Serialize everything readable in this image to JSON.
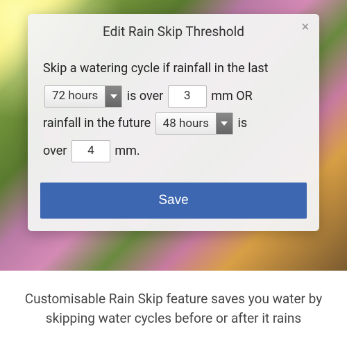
{
  "dialog": {
    "title": "Edit Rain Skip Threshold",
    "text": {
      "intro": "Skip a watering cycle if rainfall in the last",
      "is_over": "is over",
      "mm_or": "mm OR",
      "rainfall_future": "rainfall in the future",
      "is": "is",
      "over": "over",
      "mm_period": "mm."
    },
    "past_window": {
      "value": "72 hours"
    },
    "past_threshold": {
      "value": "3"
    },
    "future_window": {
      "value": "48 hours"
    },
    "future_threshold": {
      "value": "4"
    },
    "save_label": "Save"
  },
  "caption": "Customisable Rain Skip feature saves you water by skipping water cycles before or after it rains"
}
